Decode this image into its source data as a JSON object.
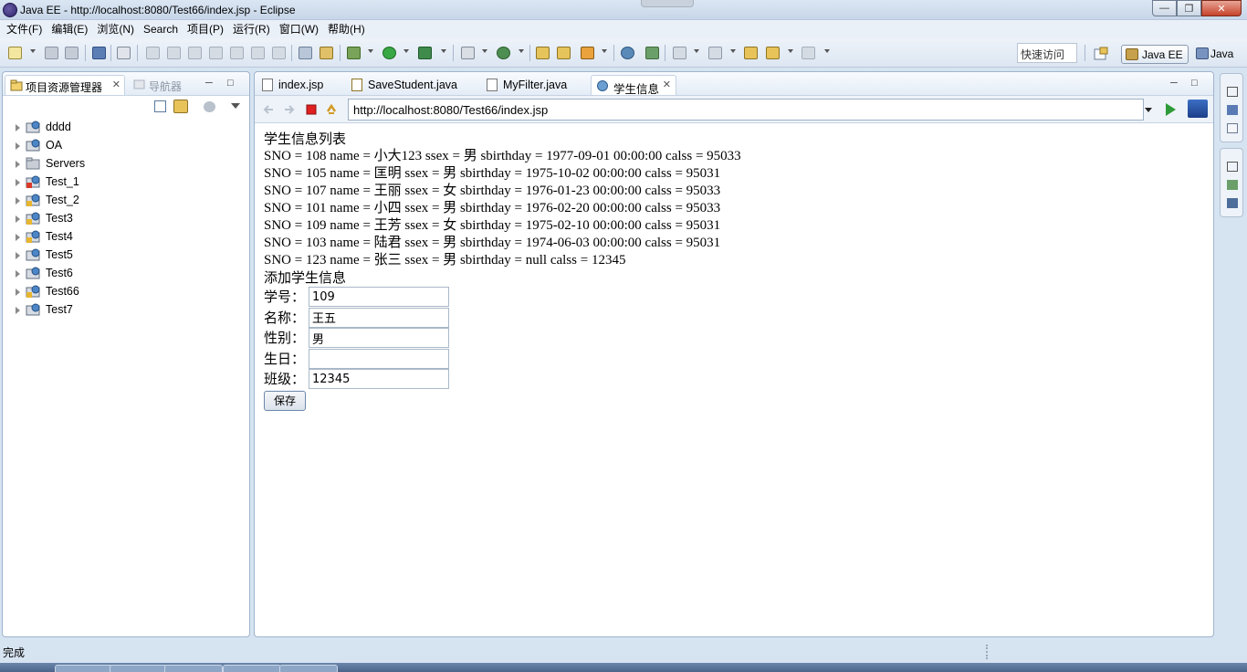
{
  "window": {
    "title": "Java EE - http://localhost:8080/Test66/index.jsp - Eclipse"
  },
  "menu": [
    "文件(F)",
    "编辑(E)",
    "浏览(N)",
    "Search",
    "项目(P)",
    "运行(R)",
    "窗口(W)",
    "帮助(H)"
  ],
  "toolbar": {
    "quick_access": "快速访问",
    "perspectives": [
      "Java EE",
      "Java"
    ]
  },
  "left_panel": {
    "tabs": [
      "项目资源管理器",
      "导航器"
    ],
    "projects": [
      "dddd",
      "OA",
      "Servers",
      "Test_1",
      "Test_2",
      "Test3",
      "Test4",
      "Test5",
      "Test6",
      "Test66",
      "Test7"
    ]
  },
  "editor": {
    "tabs": [
      "index.jsp",
      "SaveStudent.java",
      "MyFilter.java",
      "学生信息"
    ],
    "url": "http://localhost:8080/Test66/index.jsp"
  },
  "page": {
    "list_heading": "学生信息列表",
    "students": [
      "SNO = 108 name = 小大123 ssex = 男 sbirthday = 1977-09-01 00:00:00 calss = 95033",
      "SNO = 105 name = 匡明 ssex = 男 sbirthday = 1975-10-02 00:00:00 calss = 95031",
      "SNO = 107 name = 王丽 ssex = 女 sbirthday = 1976-01-23 00:00:00 calss = 95033",
      "SNO = 101 name = 小四 ssex = 男 sbirthday = 1976-02-20 00:00:00 calss = 95033",
      "SNO = 109 name = 王芳 ssex = 女 sbirthday = 1975-02-10 00:00:00 calss = 95031",
      "SNO = 103 name = 陆君 ssex = 男 sbirthday = 1974-06-03 00:00:00 calss = 95031",
      "SNO = 123 name = 张三 ssex = 男 sbirthday = null calss = 12345"
    ],
    "form_heading": "添加学生信息",
    "form": {
      "sno_label": "学号：",
      "sno_value": "109",
      "name_label": "名称：",
      "name_value": "王五",
      "sex_label": "性别：",
      "sex_value": "男",
      "birthday_label": "生日：",
      "birthday_value": "",
      "class_label": "班级：",
      "class_value": "12345",
      "save_label": "保存"
    }
  },
  "status": {
    "text": "完成"
  },
  "colors": {
    "chrome_bg": "#d6e3f1",
    "panel_border": "#9fb4cd",
    "close_button": "#c7432a",
    "stop_red": "#e02020",
    "go_green": "#2e9b38"
  }
}
